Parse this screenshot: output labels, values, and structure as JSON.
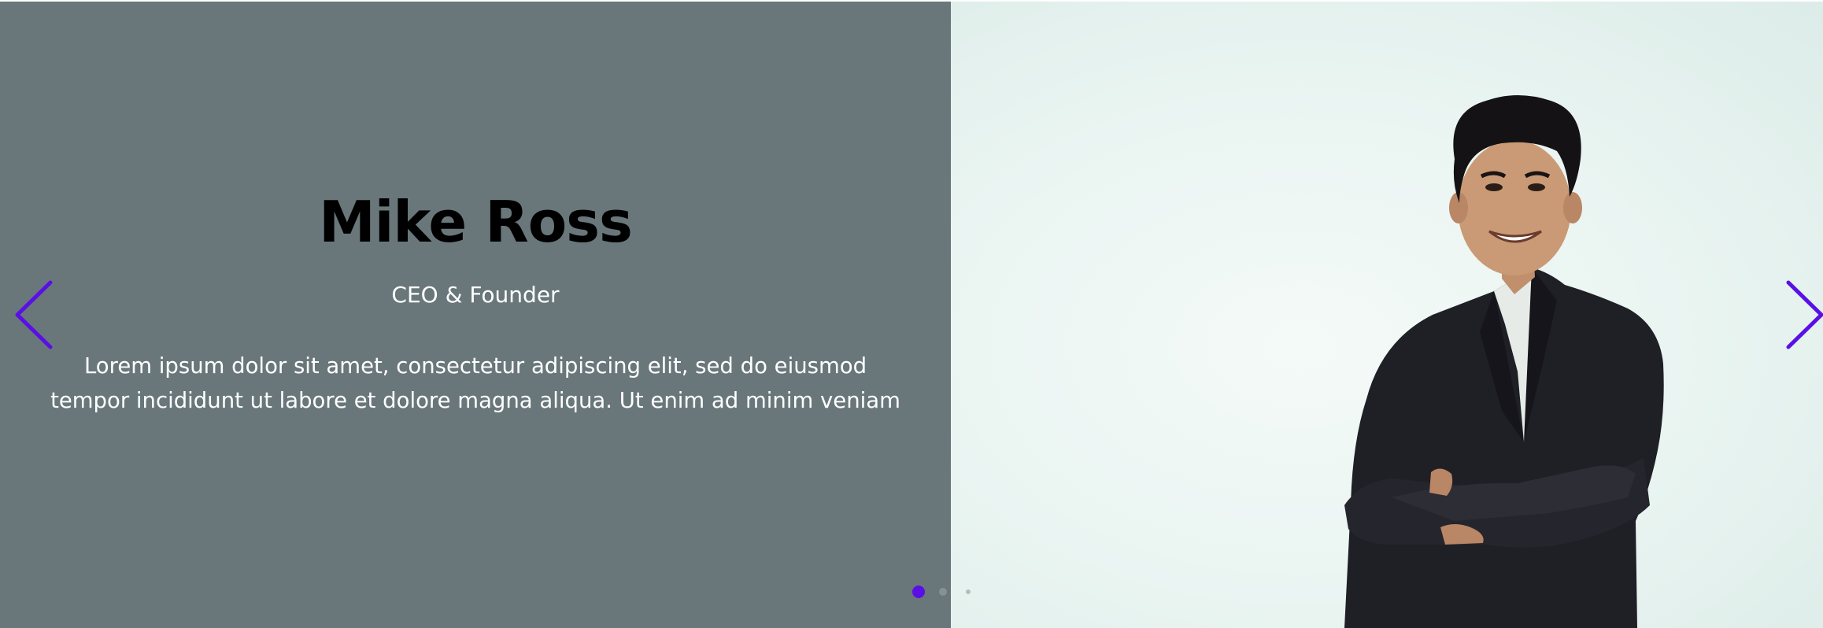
{
  "testimonial": {
    "name": "Mike Ross",
    "role": "CEO & Founder",
    "quote": "Lorem ipsum dolor sit amet, consectetur adipiscing elit, sed do eiusmod tempor incididunt ut labore et dolore magna aliqua. Ut enim ad minim veniam"
  },
  "navigation": {
    "prev_icon": "chevron-left-icon",
    "next_icon": "chevron-right-icon",
    "arrow_color": "#5a0fe6"
  },
  "pagination": {
    "total": 3,
    "active_index": 0,
    "active_color": "#5a0fe6"
  },
  "colors": {
    "left_panel": "#69777b",
    "right_panel": "#e9f4f1"
  }
}
